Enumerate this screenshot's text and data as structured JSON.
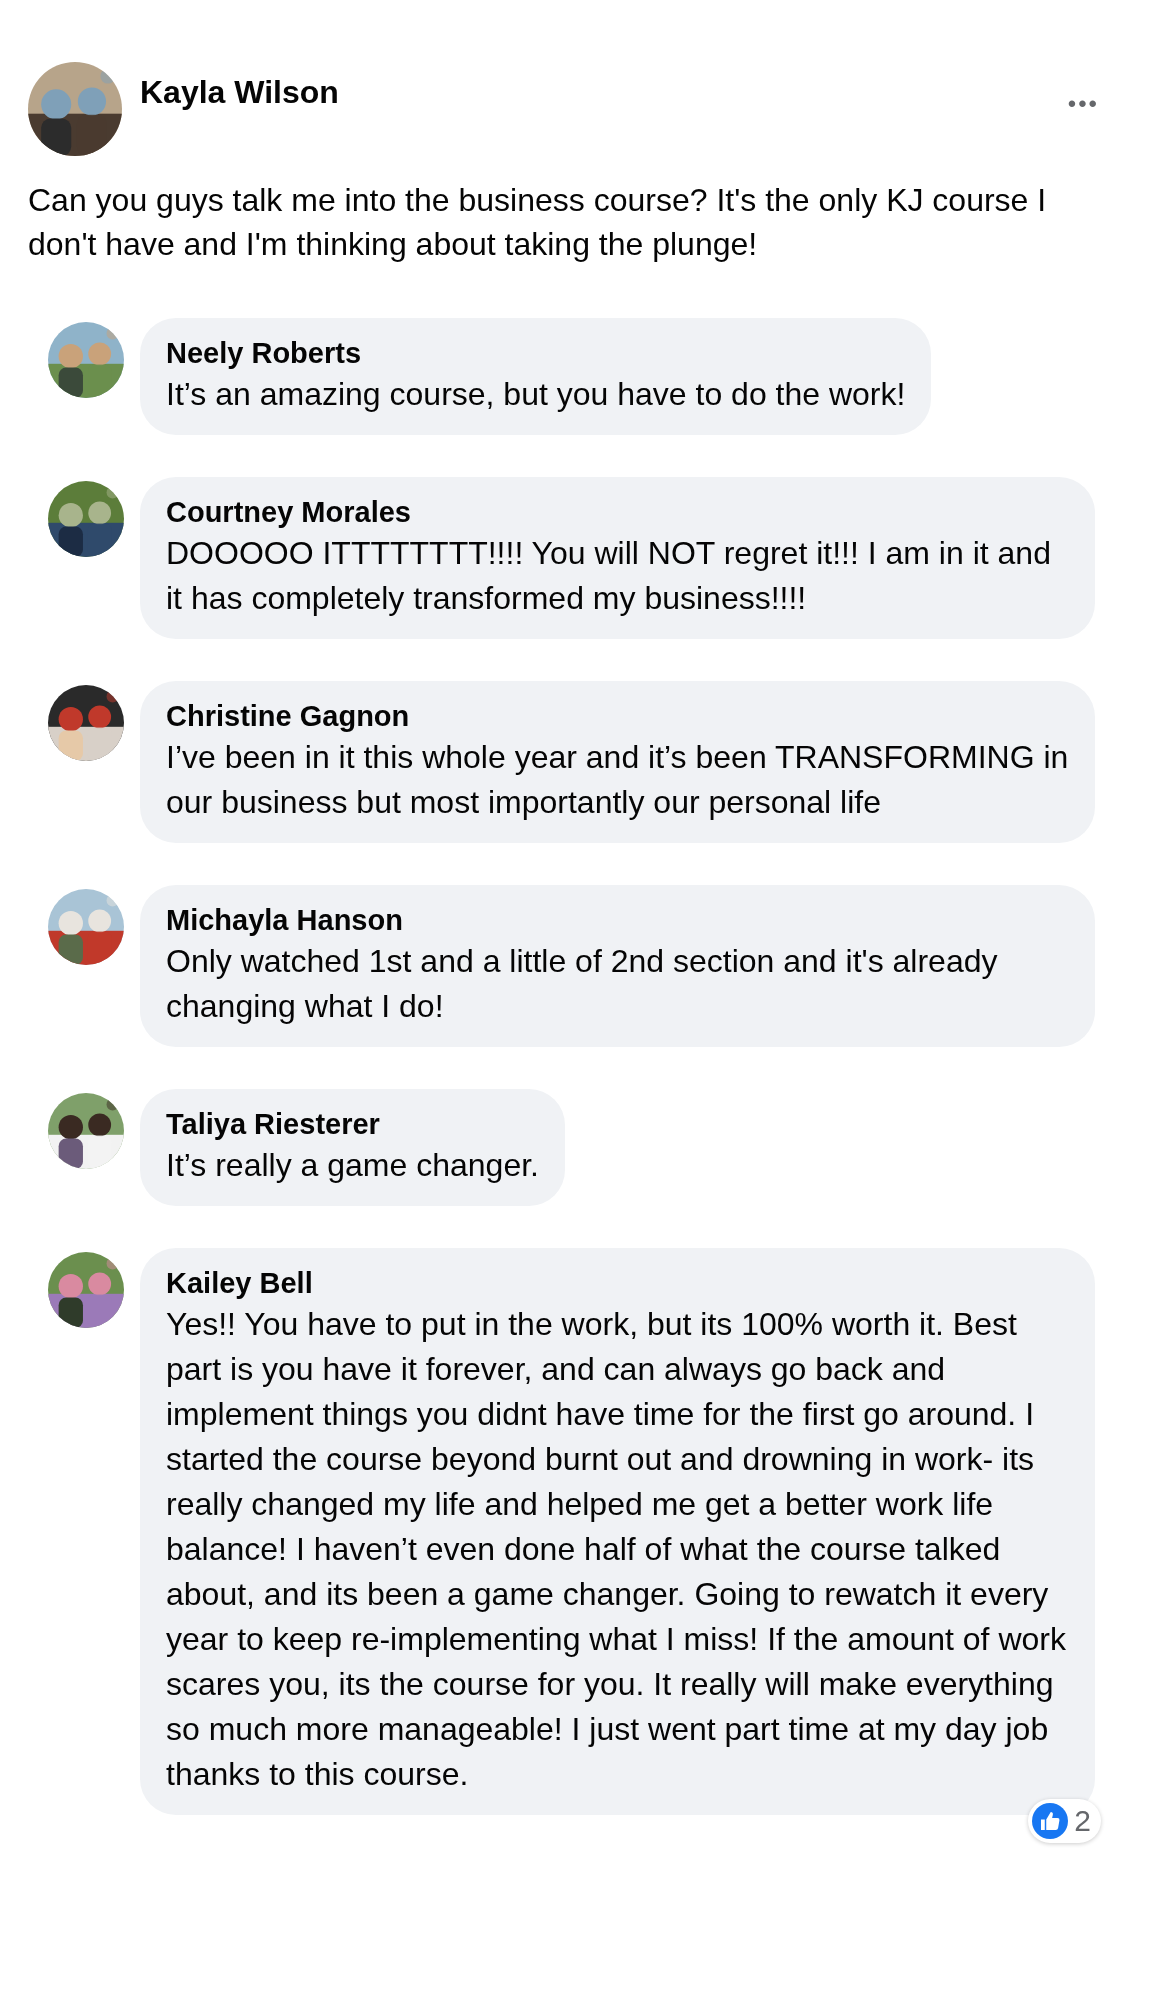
{
  "post": {
    "author": "Kayla Wilson",
    "more": "•••",
    "text": "Can you guys talk me into the business course? It's the only KJ course I don't have and I'm thinking about taking the plunge!"
  },
  "comments": [
    {
      "author": "Neely Roberts",
      "text": "It’s an amazing course, but you have to do the work!"
    },
    {
      "author": "Courtney Morales",
      "text": "DOOOOO ITTTTTTTT!!!! You will NOT regret it!!! I am in it and it has completely transformed my business!!!!"
    },
    {
      "author": "Christine Gagnon",
      "text": "I’ve been in it this whole year and it’s been TRANSFORMING in our business but most importantly our personal life"
    },
    {
      "author": "Michayla Hanson",
      "text": "Only watched 1st and a little of 2nd section and it's already changing what I do!"
    },
    {
      "author": "Taliya Riesterer",
      "text": "It’s really a game changer."
    },
    {
      "author": "Kailey Bell",
      "text": "Yes!! You have to put in the work, but its 100% worth it. Best part is you have it forever, and can always go back and implement things you didnt have time for the first go around. I started the course beyond burnt out and drowning in work- its really changed my life and helped me get a better work life balance! I haven’t even done half of what the course talked about, and its been a game changer. Going to rewatch it every year to keep re-implementing what I miss! If the amount of work scares you, its the course for you. It really will make everything so much more manageable! I just went part time at my day job thanks to this course.",
      "reactions": "2"
    }
  ]
}
